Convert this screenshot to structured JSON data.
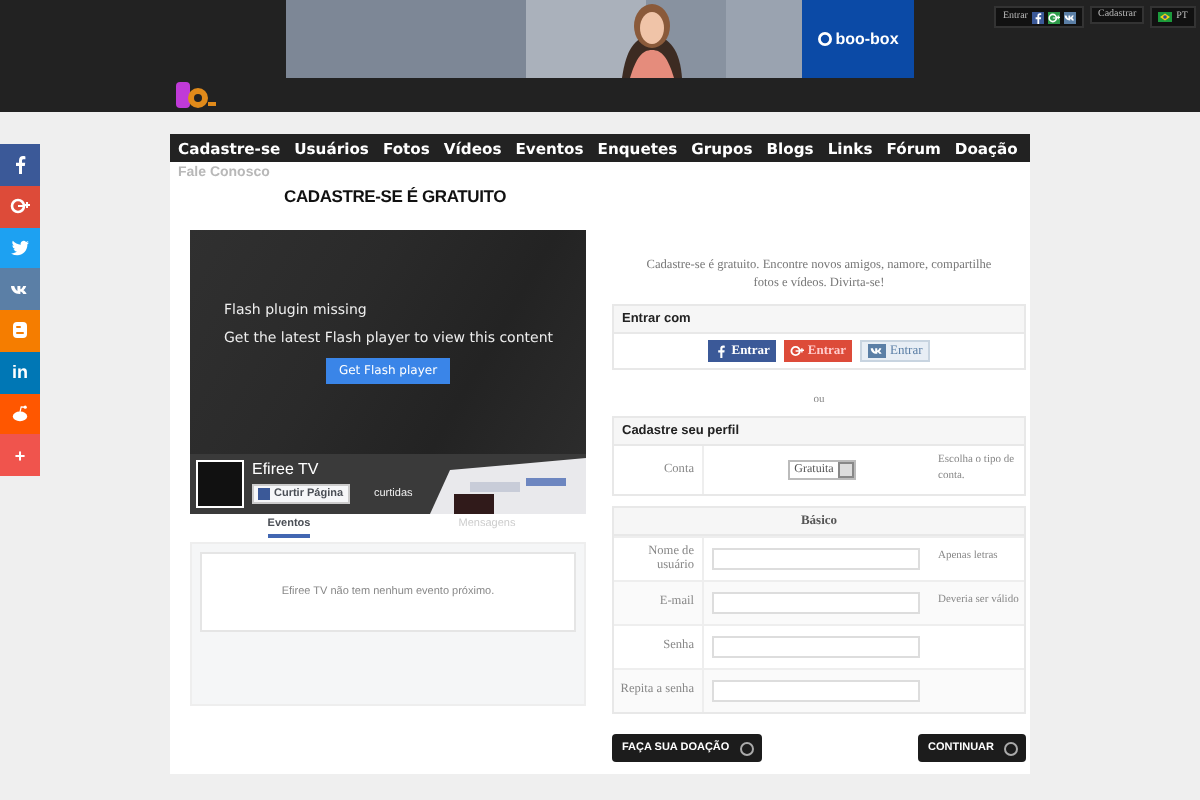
{
  "top_bar": {
    "login_label": "Entrar",
    "login_networks": [
      {
        "kind": "facebook",
        "color": "#3b5998"
      },
      {
        "kind": "google",
        "color": "#2e9c4a"
      },
      {
        "kind": "vk",
        "color": "#5b7fa6"
      }
    ],
    "register_button": "Cadastrar",
    "language": "PT"
  },
  "ad": {
    "brand": "boo-box"
  },
  "nav": [
    "Cadastre-se",
    "Usuários",
    "Fotos",
    "Vídeos",
    "Eventos",
    "Enquetes",
    "Grupos",
    "Blogs",
    "Links",
    "Fórum",
    "Doação"
  ],
  "contact_link": "Fale Conosco",
  "heading": "CADASTRE-SE É GRATUITO",
  "share_buttons": [
    {
      "kind": "facebook",
      "color": "#3b5998"
    },
    {
      "kind": "google",
      "color": "#dd4b39"
    },
    {
      "kind": "twitter",
      "color": "#1da1f2"
    },
    {
      "kind": "vk",
      "color": "#5b7fa6"
    },
    {
      "kind": "blogger",
      "color": "#f57d00"
    },
    {
      "kind": "linkedin",
      "color": "#0077b5",
      "glyph": "in"
    },
    {
      "kind": "reddit",
      "color": "#ff5700"
    },
    {
      "kind": "more",
      "color": "#f0544d",
      "glyph": "+"
    }
  ],
  "video": {
    "title": "Flash plugin missing",
    "message": "Get the latest Flash player to view this content",
    "button": "Get Flash player"
  },
  "fb_page": {
    "name": "Efiree TV",
    "like_button": "Curtir Página",
    "likes": "curtidas",
    "tabs": [
      {
        "label": "Eventos",
        "selected": true
      },
      {
        "label": "Mensagens",
        "selected": false
      }
    ],
    "empty_message": "Efiree TV não tem nenhum evento próximo."
  },
  "register": {
    "intro": "Cadastre-se é gratuito. Encontre novos amigos, namore, compartilhe fotos e vídeos. Divirta-se!",
    "login_title": "Entrar com",
    "login_buttons": [
      {
        "kind": "facebook",
        "label": "Entrar"
      },
      {
        "kind": "google",
        "label": "Entrar"
      },
      {
        "kind": "vk",
        "label": "Entrar"
      }
    ],
    "or": "ou",
    "profile_title": "Cadastre seu perfil",
    "account": {
      "label": "Conta",
      "value": "Gratuita",
      "hint": "Escolha o tipo de conta."
    },
    "basic_title": "Básico",
    "fields": [
      {
        "label": "Nome de usuário",
        "hint": "Apenas letras"
      },
      {
        "label": "E-mail",
        "hint": "Deveria ser válido"
      },
      {
        "label": "Senha"
      },
      {
        "label": "Repita a senha"
      }
    ]
  },
  "buttons": {
    "donate": "FAÇA SUA DOAÇÃO",
    "continue": "CONTINUAR"
  }
}
